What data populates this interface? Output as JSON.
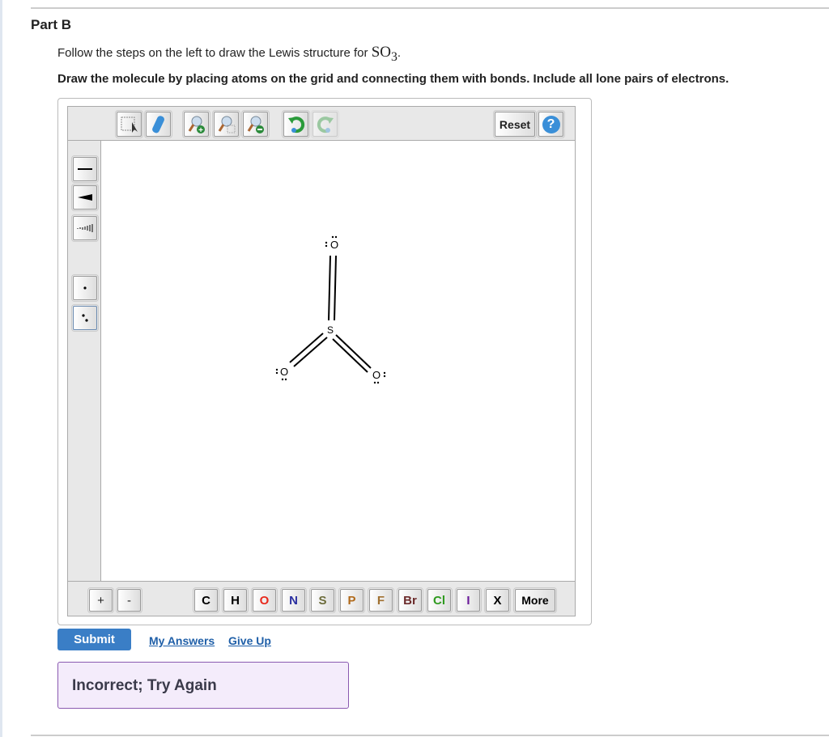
{
  "part_title": "Part B",
  "instruction": {
    "text": "Follow the steps on the left to draw the Lewis structure for ",
    "formula": "SO",
    "subscript": "3",
    "end": "."
  },
  "instruction2": "Draw the molecule by placing atoms on the grid and connecting them with bonds. Include all lone pairs of electrons.",
  "toolbar": {
    "reset_label": "Reset",
    "help_label": "?"
  },
  "elements": [
    {
      "label": "C",
      "color": "#000000"
    },
    {
      "label": "H",
      "color": "#000000"
    },
    {
      "label": "O",
      "color": "#e8291c"
    },
    {
      "label": "N",
      "color": "#2a2fa0"
    },
    {
      "label": "S",
      "color": "#6b6b3a"
    },
    {
      "label": "P",
      "color": "#b0691a"
    },
    {
      "label": "F",
      "color": "#a07030"
    },
    {
      "label": "Br",
      "color": "#6b2a2a"
    },
    {
      "label": "Cl",
      "color": "#2e9a1e"
    },
    {
      "label": "I",
      "color": "#6a1a9a"
    },
    {
      "label": "X",
      "color": "#000000"
    },
    {
      "label": "More",
      "color": "#000000"
    }
  ],
  "charge": {
    "plus": "+",
    "minus": "-"
  },
  "molecule": {
    "central": "S",
    "oxygen": "O"
  },
  "submit_label": "Submit",
  "my_answers": "My Answers",
  "give_up": "Give Up",
  "feedback": "Incorrect; Try Again"
}
